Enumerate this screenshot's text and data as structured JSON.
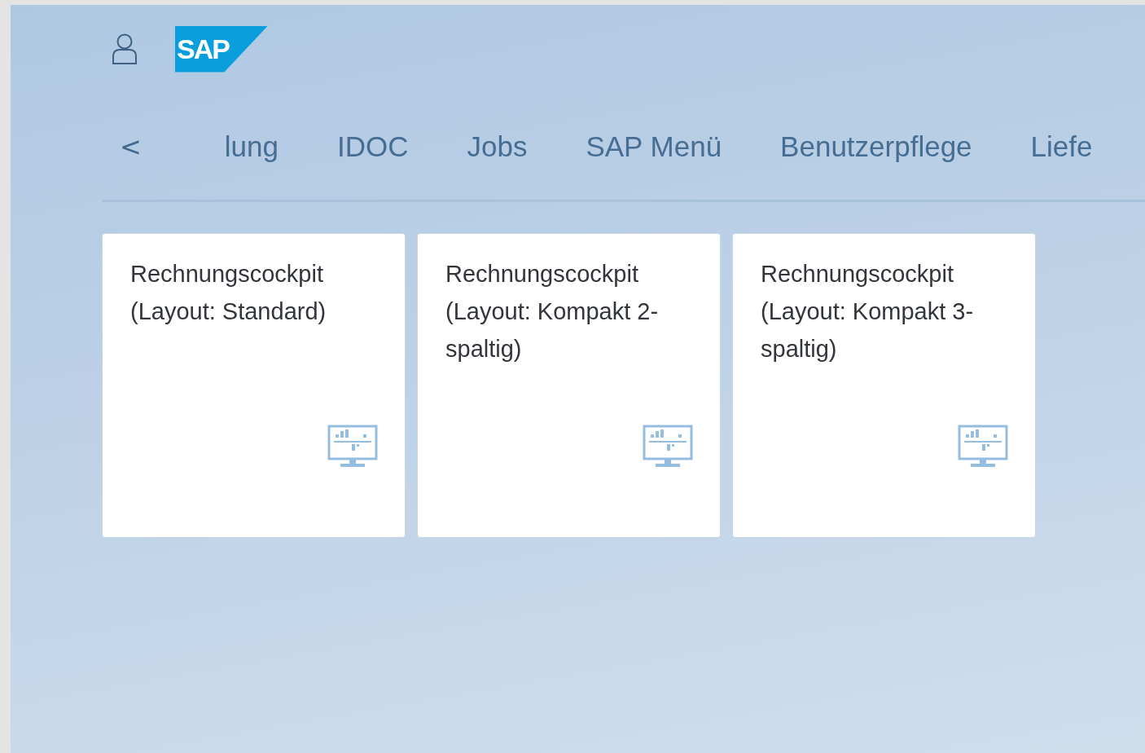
{
  "header": {
    "logo": {
      "text": "SAP"
    }
  },
  "tab_bar": {
    "back": "<",
    "tabs": [
      {
        "label": "lung"
      },
      {
        "label": "IDOC"
      },
      {
        "label": "Jobs"
      },
      {
        "label": "SAP Menü"
      },
      {
        "label": "Benutzerpflege"
      },
      {
        "label": "Liefe"
      }
    ]
  },
  "tiles": [
    {
      "title": "Rechnungscockpit (Layout: Standard)"
    },
    {
      "title": "Rechnungscockpit (Layout: Kompakt 2-spaltig)"
    },
    {
      "title": "Rechnungscockpit (Layout: Kompakt 3-spaltig)"
    }
  ]
}
